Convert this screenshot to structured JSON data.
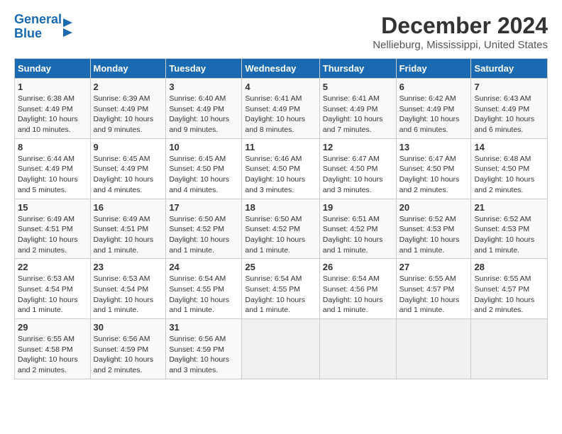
{
  "logo": {
    "line1": "General",
    "line2": "Blue"
  },
  "title": "December 2024",
  "subtitle": "Nellieburg, Mississippi, United States",
  "weekdays": [
    "Sunday",
    "Monday",
    "Tuesday",
    "Wednesday",
    "Thursday",
    "Friday",
    "Saturday"
  ],
  "weeks": [
    [
      {
        "day": "1",
        "sunrise": "6:38 AM",
        "sunset": "4:49 PM",
        "daylight": "10 hours and 10 minutes."
      },
      {
        "day": "2",
        "sunrise": "6:39 AM",
        "sunset": "4:49 PM",
        "daylight": "10 hours and 9 minutes."
      },
      {
        "day": "3",
        "sunrise": "6:40 AM",
        "sunset": "4:49 PM",
        "daylight": "10 hours and 9 minutes."
      },
      {
        "day": "4",
        "sunrise": "6:41 AM",
        "sunset": "4:49 PM",
        "daylight": "10 hours and 8 minutes."
      },
      {
        "day": "5",
        "sunrise": "6:41 AM",
        "sunset": "4:49 PM",
        "daylight": "10 hours and 7 minutes."
      },
      {
        "day": "6",
        "sunrise": "6:42 AM",
        "sunset": "4:49 PM",
        "daylight": "10 hours and 6 minutes."
      },
      {
        "day": "7",
        "sunrise": "6:43 AM",
        "sunset": "4:49 PM",
        "daylight": "10 hours and 6 minutes."
      }
    ],
    [
      {
        "day": "8",
        "sunrise": "6:44 AM",
        "sunset": "4:49 PM",
        "daylight": "10 hours and 5 minutes."
      },
      {
        "day": "9",
        "sunrise": "6:45 AM",
        "sunset": "4:49 PM",
        "daylight": "10 hours and 4 minutes."
      },
      {
        "day": "10",
        "sunrise": "6:45 AM",
        "sunset": "4:50 PM",
        "daylight": "10 hours and 4 minutes."
      },
      {
        "day": "11",
        "sunrise": "6:46 AM",
        "sunset": "4:50 PM",
        "daylight": "10 hours and 3 minutes."
      },
      {
        "day": "12",
        "sunrise": "6:47 AM",
        "sunset": "4:50 PM",
        "daylight": "10 hours and 3 minutes."
      },
      {
        "day": "13",
        "sunrise": "6:47 AM",
        "sunset": "4:50 PM",
        "daylight": "10 hours and 2 minutes."
      },
      {
        "day": "14",
        "sunrise": "6:48 AM",
        "sunset": "4:50 PM",
        "daylight": "10 hours and 2 minutes."
      }
    ],
    [
      {
        "day": "15",
        "sunrise": "6:49 AM",
        "sunset": "4:51 PM",
        "daylight": "10 hours and 2 minutes."
      },
      {
        "day": "16",
        "sunrise": "6:49 AM",
        "sunset": "4:51 PM",
        "daylight": "10 hours and 1 minute."
      },
      {
        "day": "17",
        "sunrise": "6:50 AM",
        "sunset": "4:52 PM",
        "daylight": "10 hours and 1 minute."
      },
      {
        "day": "18",
        "sunrise": "6:50 AM",
        "sunset": "4:52 PM",
        "daylight": "10 hours and 1 minute."
      },
      {
        "day": "19",
        "sunrise": "6:51 AM",
        "sunset": "4:52 PM",
        "daylight": "10 hours and 1 minute."
      },
      {
        "day": "20",
        "sunrise": "6:52 AM",
        "sunset": "4:53 PM",
        "daylight": "10 hours and 1 minute."
      },
      {
        "day": "21",
        "sunrise": "6:52 AM",
        "sunset": "4:53 PM",
        "daylight": "10 hours and 1 minute."
      }
    ],
    [
      {
        "day": "22",
        "sunrise": "6:53 AM",
        "sunset": "4:54 PM",
        "daylight": "10 hours and 1 minute."
      },
      {
        "day": "23",
        "sunrise": "6:53 AM",
        "sunset": "4:54 PM",
        "daylight": "10 hours and 1 minute."
      },
      {
        "day": "24",
        "sunrise": "6:54 AM",
        "sunset": "4:55 PM",
        "daylight": "10 hours and 1 minute."
      },
      {
        "day": "25",
        "sunrise": "6:54 AM",
        "sunset": "4:55 PM",
        "daylight": "10 hours and 1 minute."
      },
      {
        "day": "26",
        "sunrise": "6:54 AM",
        "sunset": "4:56 PM",
        "daylight": "10 hours and 1 minute."
      },
      {
        "day": "27",
        "sunrise": "6:55 AM",
        "sunset": "4:57 PM",
        "daylight": "10 hours and 1 minute."
      },
      {
        "day": "28",
        "sunrise": "6:55 AM",
        "sunset": "4:57 PM",
        "daylight": "10 hours and 2 minutes."
      }
    ],
    [
      {
        "day": "29",
        "sunrise": "6:55 AM",
        "sunset": "4:58 PM",
        "daylight": "10 hours and 2 minutes."
      },
      {
        "day": "30",
        "sunrise": "6:56 AM",
        "sunset": "4:59 PM",
        "daylight": "10 hours and 2 minutes."
      },
      {
        "day": "31",
        "sunrise": "6:56 AM",
        "sunset": "4:59 PM",
        "daylight": "10 hours and 3 minutes."
      },
      null,
      null,
      null,
      null
    ]
  ],
  "labels": {
    "sunrise": "Sunrise:",
    "sunset": "Sunset:",
    "daylight": "Daylight:"
  }
}
